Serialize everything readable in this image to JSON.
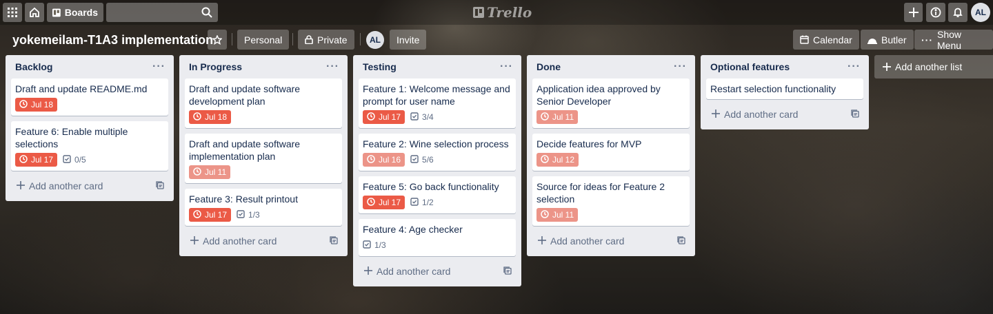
{
  "nav": {
    "apps_icon": "grid-icon",
    "home_icon": "home-icon",
    "boards_label": "Boards",
    "search_value": "",
    "logo_text": "Trello",
    "user_initials": "AL"
  },
  "board": {
    "title": "yokemeilam-T1A3 implementation",
    "visibility_team": "Personal",
    "visibility_privacy": "Private",
    "member_initials": "AL",
    "invite_label": "Invite",
    "calendar_label": "Calendar",
    "butler_label": "Butler",
    "show_menu_label": "Show Menu"
  },
  "colors": {
    "overdue": "#eb5a46",
    "past_due": "#ec9488",
    "list_bg": "#ebecf0"
  },
  "add_card_label": "Add another card",
  "add_list_label": "Add another list",
  "lists": [
    {
      "title": "Backlog",
      "cards": [
        {
          "title": "Draft and update README.md",
          "due": "Jul 18",
          "due_style": "overdue",
          "checklist": ""
        },
        {
          "title": "Feature 6: Enable multiple selections",
          "due": "Jul 17",
          "due_style": "overdue",
          "checklist": "0/5"
        }
      ]
    },
    {
      "title": "In Progress",
      "cards": [
        {
          "title": "Draft and update software development plan",
          "due": "Jul 18",
          "due_style": "overdue",
          "checklist": ""
        },
        {
          "title": "Draft and update software implementation plan",
          "due": "Jul 11",
          "due_style": "past",
          "checklist": ""
        },
        {
          "title": "Feature 3: Result printout",
          "due": "Jul 17",
          "due_style": "overdue",
          "checklist": "1/3"
        }
      ]
    },
    {
      "title": "Testing",
      "cards": [
        {
          "title": "Feature 1: Welcome message and prompt for user name",
          "due": "Jul 17",
          "due_style": "overdue",
          "checklist": "3/4"
        },
        {
          "title": "Feature 2: Wine selection process",
          "due": "Jul 16",
          "due_style": "past",
          "checklist": "5/6"
        },
        {
          "title": "Feature 5: Go back functionality",
          "due": "Jul 17",
          "due_style": "overdue",
          "checklist": "1/2"
        },
        {
          "title": "Feature 4: Age checker",
          "due": "",
          "due_style": "",
          "checklist": "1/3"
        }
      ]
    },
    {
      "title": "Done",
      "cards": [
        {
          "title": "Application idea approved by Senior Developer",
          "due": "Jul 11",
          "due_style": "past",
          "checklist": ""
        },
        {
          "title": "Decide features for MVP",
          "due": "Jul 12",
          "due_style": "past",
          "checklist": ""
        },
        {
          "title": "Source for ideas for Feature 2 selection",
          "due": "Jul 11",
          "due_style": "past",
          "checklist": ""
        }
      ]
    },
    {
      "title": "Optional features",
      "cards": [
        {
          "title": "Restart selection functionality",
          "due": "",
          "due_style": "",
          "checklist": ""
        }
      ]
    }
  ]
}
